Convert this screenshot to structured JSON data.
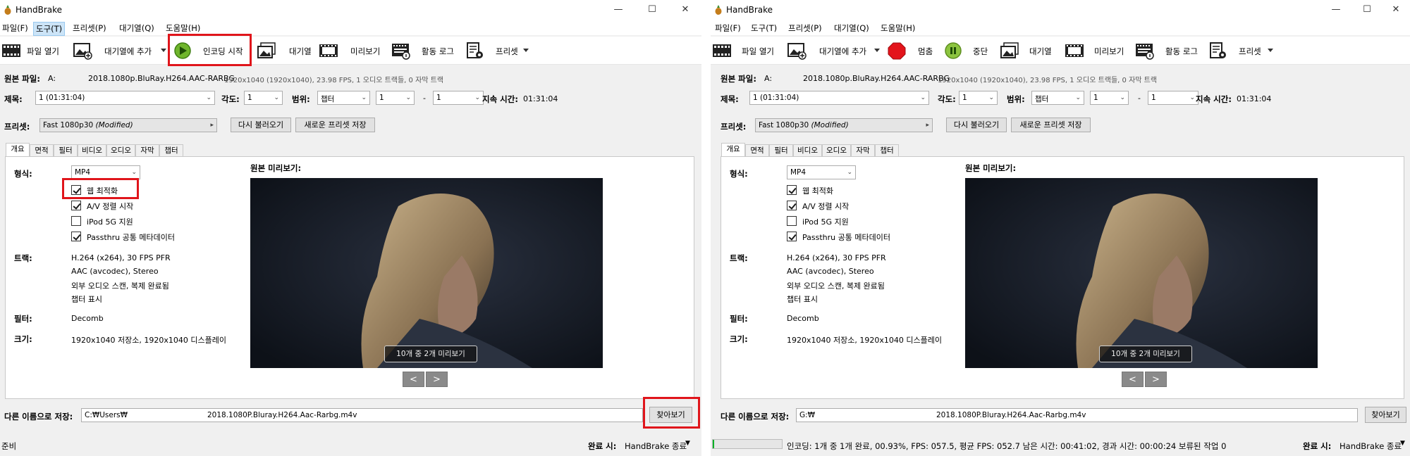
{
  "left": {
    "app_title": "HandBrake",
    "menu": [
      "파일(F)",
      "도구(T)",
      "프리셋(P)",
      "대기열(Q)",
      "도움말(H)"
    ],
    "toolbar": {
      "open": "파일 열기",
      "add_queue": "대기열에 추가",
      "start": "인코딩 시작",
      "queue": "대기열",
      "preview": "미리보기",
      "log": "활동 로그",
      "presets": "프리셋"
    },
    "source_label": "원본 파일:",
    "source_drive": "A:",
    "source_file": "2018.1080p.BluRay.H264.AAC-RARBG",
    "source_info": "1920x1040 (1920x1040), 23.98 FPS, 1 오디오 트랙들, 0 자막 트랙",
    "title_label": "제목:",
    "title_value": "1 (01:31:04)",
    "angle_label": "각도:",
    "angle_value": "1",
    "range_label": "범위:",
    "range_value": "챕터",
    "range_from": "1",
    "range_dash": "-",
    "range_to": "1",
    "duration_label": "지속 시간:",
    "duration_value": "01:31:04",
    "preset_label": "프리셋:",
    "preset_name": "Fast 1080p30",
    "preset_modified": "(Modified)",
    "reload_btn": "다시 불러오기",
    "save_preset_btn": "새로운 프리셋 저장",
    "tabs": [
      "개요",
      "면적",
      "필터",
      "비디오",
      "오디오",
      "자막",
      "챕터"
    ],
    "format_label": "형식:",
    "format_value": "MP4",
    "checks": [
      {
        "label": "웹 최적화",
        "checked": true
      },
      {
        "label": "A/V 정렬 시작",
        "checked": true
      },
      {
        "label": "iPod 5G 지원",
        "checked": false
      },
      {
        "label": "Passthru 공통 메타데이터",
        "checked": true
      }
    ],
    "tracks_label": "트랙:",
    "tracks": [
      "H.264 (x264), 30 FPS PFR",
      "AAC (avcodec), Stereo",
      "외부 오디오 스캔, 복제 완료됨",
      "챕터 표시"
    ],
    "filter_label": "필터:",
    "filter_value": "Decomb",
    "size_label": "크기:",
    "size_value": "1920x1040 저장소, 1920x1040 디스플레이",
    "preview_heading": "원본 미리보기:",
    "preview_counter": "10개 중 2개 미리보기",
    "prev_btn": "<",
    "next_btn": ">",
    "saveas_label": "다른 이름으로 저장:",
    "saveas_dir": "C:₩Users₩",
    "saveas_file": "2018.1080P.Bluray.H264.Aac-Rarbg.m4v",
    "browse_btn": "찾아보기",
    "status_text": "준비",
    "when_done_label": "완료 시:",
    "when_done_value": "HandBrake 종료"
  },
  "right": {
    "app_title": "HandBrake",
    "menu": [
      "파일(F)",
      "도구(T)",
      "프리셋(P)",
      "대기열(Q)",
      "도움말(H)"
    ],
    "toolbar": {
      "open": "파일 열기",
      "add_queue": "대기열에 추가",
      "stop": "멈춤",
      "pause": "중단",
      "queue": "대기열",
      "preview": "미리보기",
      "log": "활동 로그",
      "presets": "프리셋"
    },
    "source_label": "원본 파일:",
    "source_drive": "A:",
    "source_file": "2018.1080p.BluRay.H264.AAC-RARBG",
    "source_info": "1920x1040 (1920x1040), 23.98 FPS, 1 오디오 트랙들, 0 자막 트랙",
    "title_label": "제목:",
    "title_value": "1 (01:31:04)",
    "angle_label": "각도:",
    "angle_value": "1",
    "range_label": "범위:",
    "range_value": "챕터",
    "range_from": "1",
    "range_dash": "-",
    "range_to": "1",
    "duration_label": "지속 시간:",
    "duration_value": "01:31:04",
    "preset_label": "프리셋:",
    "preset_name": "Fast 1080p30",
    "preset_modified": "(Modified)",
    "reload_btn": "다시 불러오기",
    "save_preset_btn": "새로운 프리셋 저장",
    "tabs": [
      "개요",
      "면적",
      "필터",
      "비디오",
      "오디오",
      "자막",
      "챕터"
    ],
    "format_label": "형식:",
    "format_value": "MP4",
    "checks": [
      {
        "label": "웹 최적화",
        "checked": true
      },
      {
        "label": "A/V 정렬 시작",
        "checked": true
      },
      {
        "label": "iPod 5G 지원",
        "checked": false
      },
      {
        "label": "Passthru 공통 메타데이터",
        "checked": true
      }
    ],
    "tracks_label": "트랙:",
    "tracks": [
      "H.264 (x264), 30 FPS PFR",
      "AAC (avcodec), Stereo",
      "외부 오디오 스캔, 복제 완료됨",
      "챕터 표시"
    ],
    "filter_label": "필터:",
    "filter_value": "Decomb",
    "size_label": "크기:",
    "size_value": "1920x1040 저장소, 1920x1040 디스플레이",
    "preview_heading": "원본 미리보기:",
    "preview_counter": "10개 중 2개 미리보기",
    "prev_btn": "<",
    "next_btn": ">",
    "saveas_label": "다른 이름으로 저장:",
    "saveas_dir": "G:₩",
    "saveas_file": "2018.1080P.Bluray.H264.Aac-Rarbg.m4v",
    "browse_btn": "찾아보기",
    "progress": 0.0093,
    "status_text": "인코딩: 1개 중 1개 완료, 00.93%, FPS: 057.5, 평균 FPS: 052.7 남은 시간: 00:41:02, 경과 시간: 00:00:24   보류된 작업 0",
    "when_done_label": "완료 시:",
    "when_done_value": "HandBrake 종료"
  },
  "colors": {
    "highlight": "#e0151b",
    "play_green": "#6fb52c",
    "stop_red": "#e3141b",
    "pause_green": "#8cc43f",
    "progress_green": "#06b025"
  },
  "icons": [
    "film-icon",
    "add-image-icon",
    "play-icon",
    "stop-icon",
    "pause-icon",
    "queue-icon",
    "preview-icon",
    "log-icon",
    "preset-icon"
  ]
}
